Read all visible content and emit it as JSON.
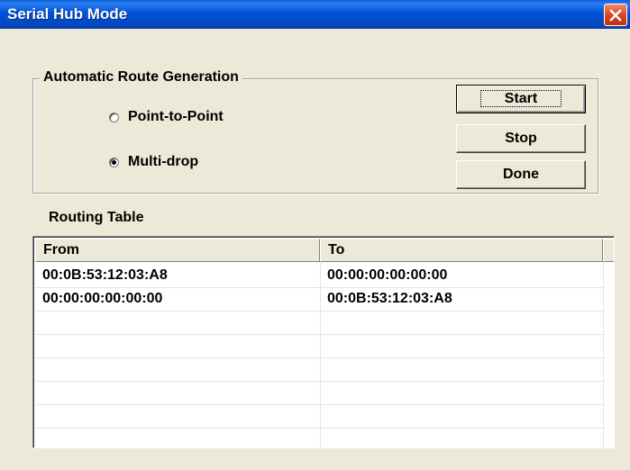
{
  "window": {
    "title": "Serial Hub Mode"
  },
  "route_group": {
    "title": "Automatic Route Generation",
    "options": [
      {
        "label": "Point-to-Point",
        "selected": false
      },
      {
        "label": "Multi-drop",
        "selected": true
      }
    ],
    "buttons": {
      "start": "Start",
      "stop": "Stop",
      "done": "Done"
    }
  },
  "routing_table": {
    "label": "Routing Table",
    "columns": [
      "From",
      "To"
    ],
    "rows": [
      {
        "from": "00:0B:53:12:03:A8",
        "to": "00:00:00:00:00:00"
      },
      {
        "from": "00:00:00:00:00:00",
        "to": "00:0B:53:12:03:A8"
      }
    ]
  },
  "colors": {
    "titlebar": "#0053d8",
    "dialog_bg": "#ece9d8",
    "close_button": "#d8431c"
  }
}
